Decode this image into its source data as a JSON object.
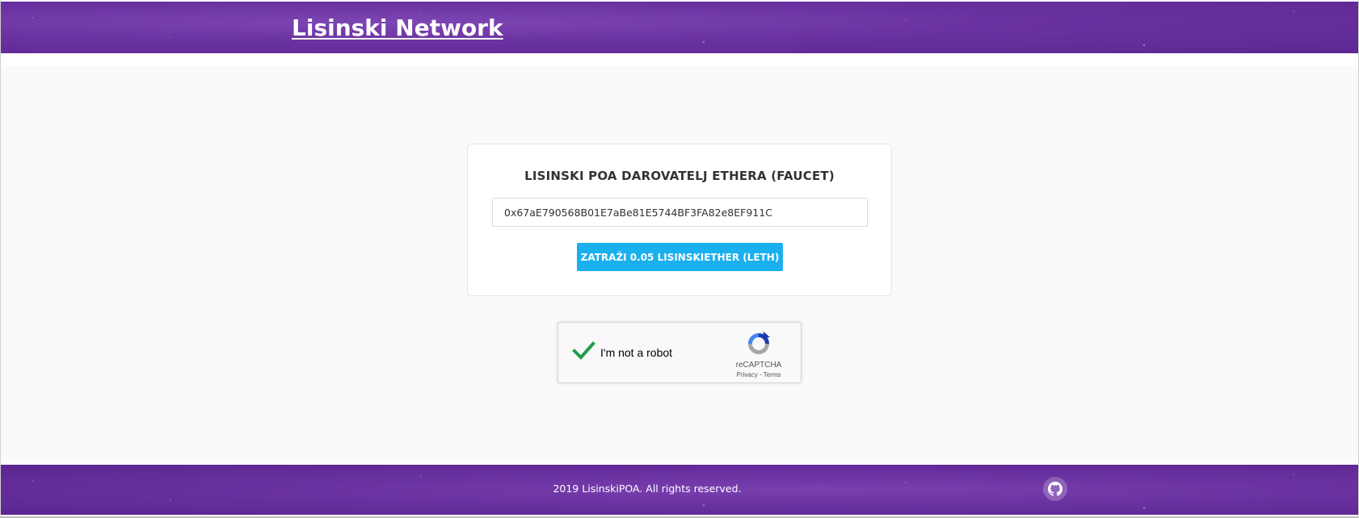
{
  "header": {
    "site_title": "Lisinski Network"
  },
  "faucet": {
    "title": "LISINSKI POA DAROVATELJ ETHERA (FAUCET)",
    "address_value": "0x67aE790568B01E7aBe81E5744BF3FA82e8EF911C",
    "request_button_label": "ZATRAŽI 0.05 LISINSKIETHER (LETH)"
  },
  "recaptcha": {
    "label": "I'm not a robot",
    "brand": "reCAPTCHA",
    "privacy_link": "Privacy",
    "separator": " - ",
    "terms_link": "Terms",
    "checked": true,
    "check_icon": "checkmark-icon",
    "logo_icon": "recaptcha-logo-icon"
  },
  "footer": {
    "copyright": "2019 LisinskiPOA. All rights reserved.",
    "github_icon": "github-icon"
  },
  "colors": {
    "brand_purple": "#6a31a1",
    "button_blue": "#1ab0ee",
    "check_green": "#1e9e4a"
  }
}
